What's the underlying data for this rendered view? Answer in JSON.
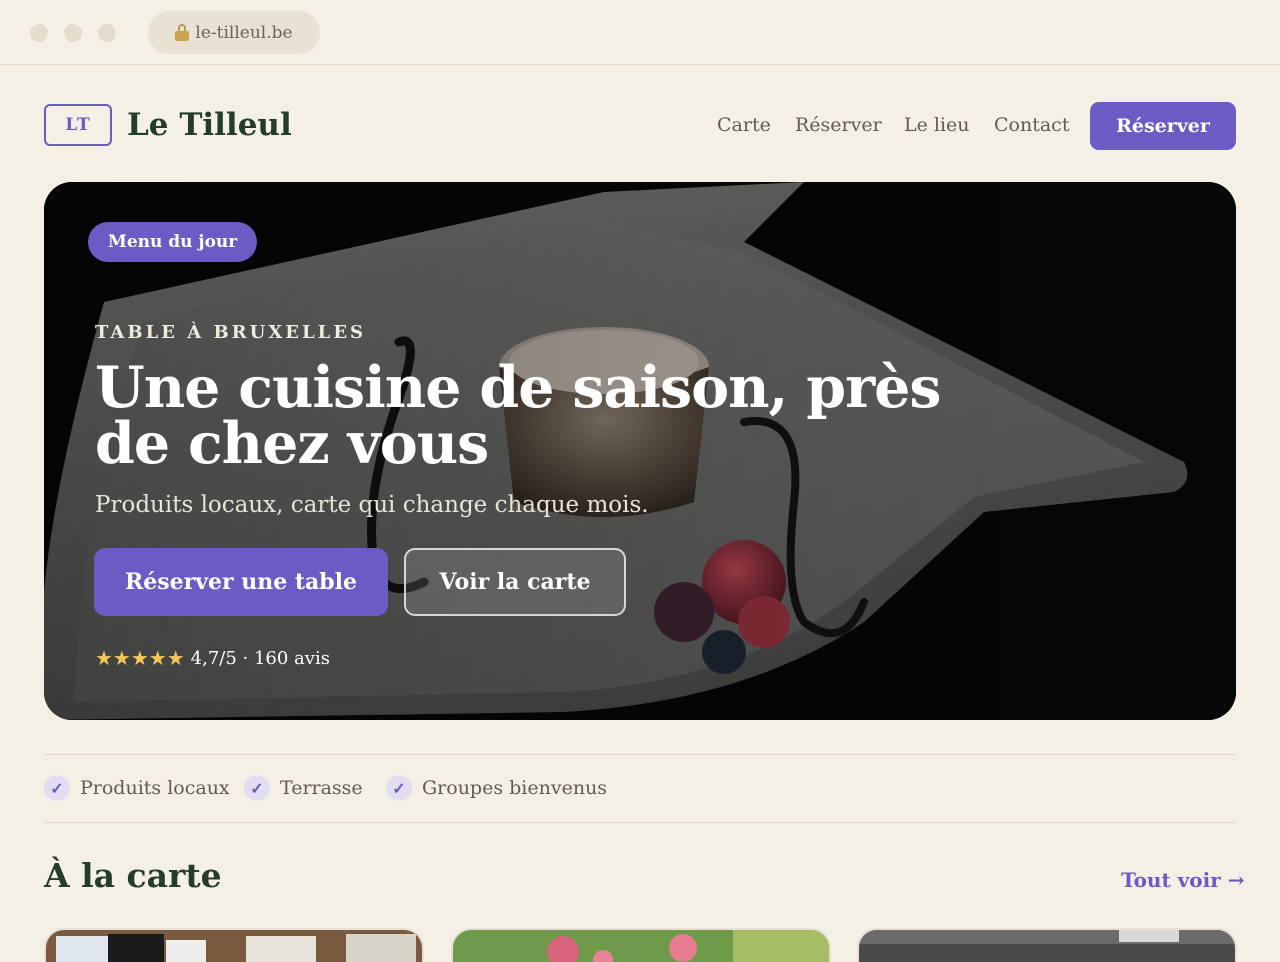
{
  "browser": {
    "url": "le-tilleul.be",
    "lock_icon": "lock-icon"
  },
  "header": {
    "logo_monogram": "LT",
    "logo_name": "Le Tilleul",
    "nav": [
      "Carte",
      "Réserver",
      "Le lieu",
      "Contact"
    ],
    "cta_label": "Réserver"
  },
  "hero": {
    "badge": "Menu du jour",
    "eyebrow": "TABLE À BRUXELLES",
    "headline": "Une cuisine de saison, près de chez vous",
    "subtitle": "Produits locaux, carte qui change chaque mois.",
    "primary_button": "Réserver une table",
    "secondary_button": "Voir la carte",
    "stars": "★★★★★",
    "rating_text": "4,7/5 · 160 avis",
    "rating_value": 4.7
  },
  "features": [
    {
      "check": "✓",
      "label": "Produits locaux"
    },
    {
      "check": "✓",
      "label": "Terrasse"
    },
    {
      "check": "✓",
      "label": "Groupes bienvenus"
    }
  ],
  "menu_section": {
    "title": "À la carte",
    "see_all": "Tout voir →"
  },
  "colors": {
    "accent": "#6b5bc4",
    "brand_green": "#243d28",
    "background": "#f5f0e6",
    "star": "#f4c65a"
  }
}
